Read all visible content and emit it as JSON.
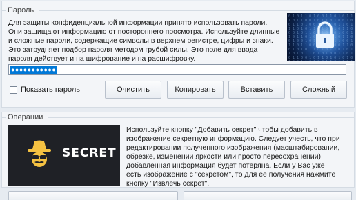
{
  "password_section": {
    "title": "Пароль",
    "description": "Для защиты конфиденциальной информации принято использовать пароли. Они защищают информацию от постороннего просмотра. Используйте длинные и сложные пароли, содержащие символы в верхнем регистре, цифры и знаки. Это затрудняет подбор пароля методом грубой силы. Это поле для ввода пароля действует и на шифрование и на расшифровку.",
    "password_masked": "●●●●●●●●●●●",
    "show_password_label": "Показать пароль",
    "show_password_checked": false,
    "buttons": {
      "clear": "Очистить",
      "copy": "Копировать",
      "paste": "Вставить",
      "hard": "Сложный"
    }
  },
  "operations_section": {
    "title": "Операции",
    "image_label": "SECRET",
    "description": "Используйте кнопку \"Добавить секрет\" чтобы добавить в изображение секретную информацию. Следует учесть, что при редактировании полученного изображения (масштабировании, обрезке, изменении яркости или просто пересохранении) добавленная информация будет потеряна. Если у Вас уже есть изображение с \"секретом\", то для её получения нажмите кнопку \"Извлечь секрет\"."
  },
  "colors": {
    "background": "#e6ebf1",
    "selection": "#0078d7",
    "secret_bg": "#1f2126",
    "secret_icon": "#f5c242"
  }
}
